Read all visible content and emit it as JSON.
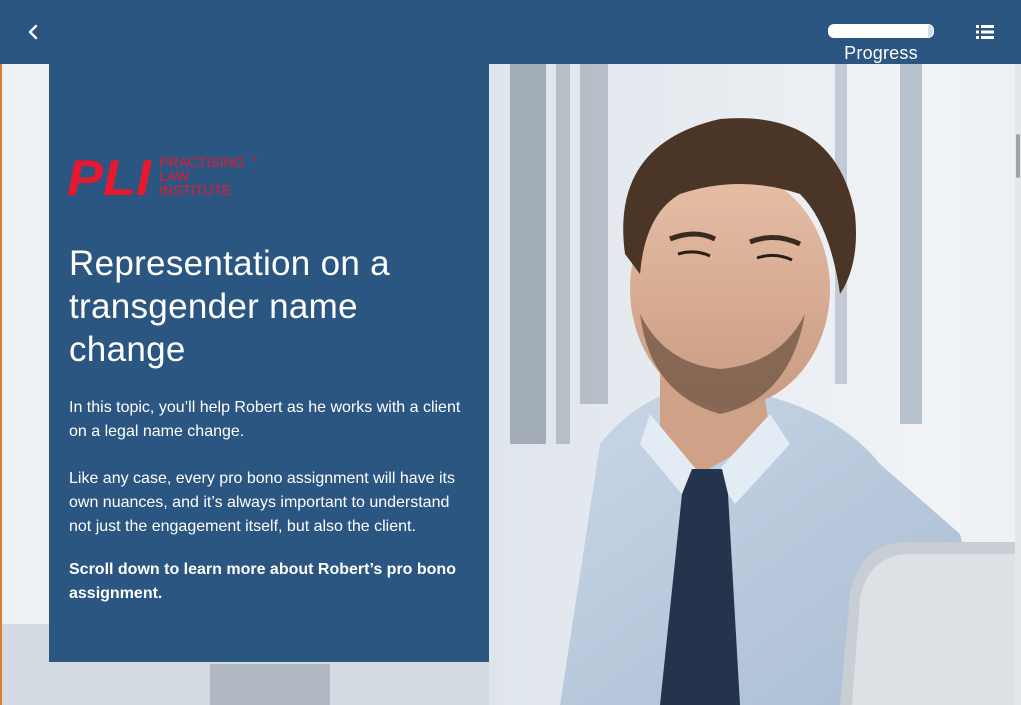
{
  "header": {
    "back_icon": "chevron-left-icon",
    "progress_label": "Progress",
    "progress_fraction": 0.95,
    "menu_icon": "list-menu-icon"
  },
  "logo": {
    "mark": "PLI",
    "line1": "PRACTISING",
    "line2": "LAW",
    "line3": "INSTITUTE",
    "color": "#e8182e"
  },
  "content": {
    "title": "Representation on a transgender name change",
    "paragraph1": "In this topic, you’ll help Robert as he works with a client on a legal name change.",
    "paragraph2": "Like any case, every pro bono assignment will have its own nuances, and it’s always important to understand not just the engagement itself, but also the client.",
    "paragraph3": "Scroll down to learn more about Robert’s pro bono assignment."
  },
  "colors": {
    "brand_blue": "#2b5681",
    "accent_orange": "#e07b2a"
  }
}
